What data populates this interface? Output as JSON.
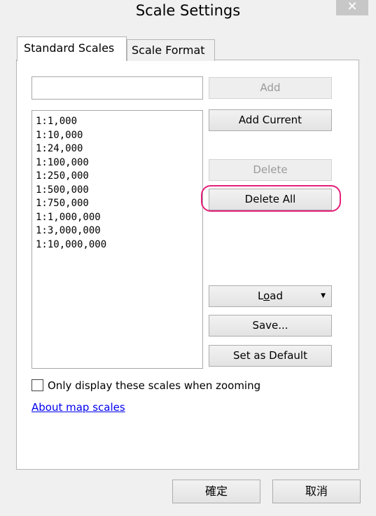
{
  "window": {
    "title": "Scale Settings",
    "close_glyph": "✕"
  },
  "tabs": [
    {
      "label": "Standard Scales",
      "active": true
    },
    {
      "label": "Scale Format",
      "active": false
    }
  ],
  "scale_input": {
    "value": ""
  },
  "scales": [
    "1:1,000",
    "1:10,000",
    "1:24,000",
    "1:100,000",
    "1:250,000",
    "1:500,000",
    "1:750,000",
    "1:1,000,000",
    "1:3,000,000",
    "1:10,000,000"
  ],
  "buttons": {
    "add": "Add",
    "add_current": "Add Current",
    "delete": "Delete",
    "delete_all": "Delete All",
    "load_prefix": "L",
    "load_underlined": "o",
    "load_suffix": "ad",
    "load_arrow": "▼",
    "save": "Save...",
    "set_default": "Set as Default"
  },
  "checkbox": {
    "label": "Only display these scales when zooming",
    "checked": false
  },
  "link": {
    "label": "About map scales"
  },
  "footer": {
    "ok": "確定",
    "cancel": "取消"
  },
  "colors": {
    "highlight": "#e5207a",
    "link": "#0000ee"
  }
}
